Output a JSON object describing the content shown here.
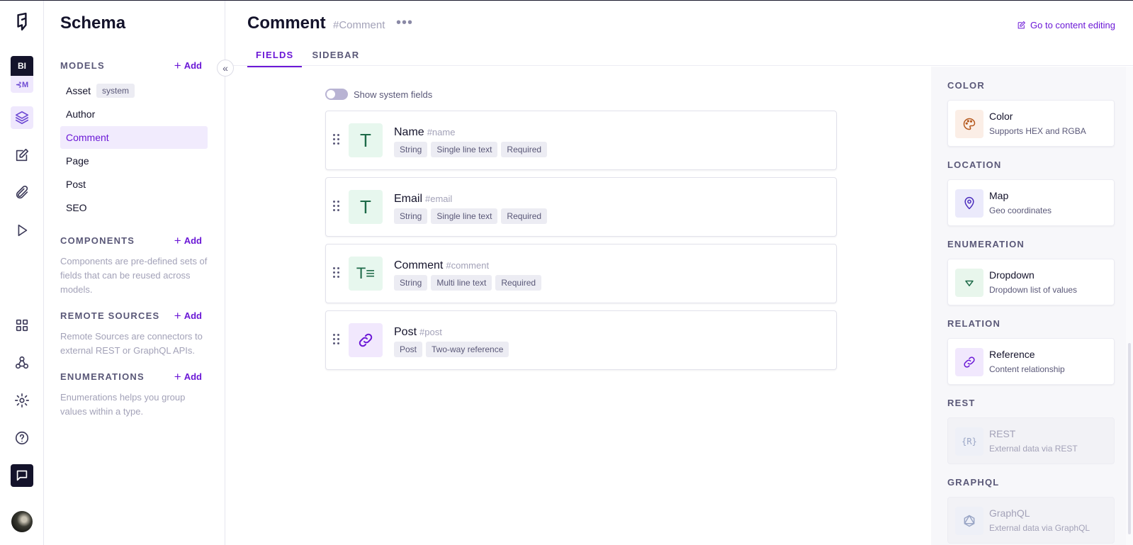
{
  "rail": {
    "project_initials": "BI",
    "project_sub": "⊰M",
    "items": [
      "logo-icon",
      "schema-icon",
      "content-icon",
      "assets-icon",
      "playground-icon",
      "apps-icon",
      "webhooks-icon",
      "settings-icon",
      "help-icon",
      "chat-icon"
    ]
  },
  "schema": {
    "title": "Schema",
    "models_title": "MODELS",
    "add_label": "Add",
    "models": [
      {
        "name": "Asset",
        "tag": "system"
      },
      {
        "name": "Author"
      },
      {
        "name": "Comment"
      },
      {
        "name": "Page"
      },
      {
        "name": "Post"
      },
      {
        "name": "SEO"
      }
    ],
    "components_title": "COMPONENTS",
    "components_desc": "Components are pre-defined sets of fields that can be reused across models.",
    "remote_title": "REMOTE SOURCES",
    "remote_desc": "Remote Sources are connectors to external REST or GraphQL APIs.",
    "enums_title": "ENUMERATIONS",
    "enums_desc": "Enumerations helps you group values within a type."
  },
  "main": {
    "title": "Comment",
    "api_id": "#Comment",
    "more": "•••",
    "tabs": [
      "FIELDS",
      "SIDEBAR"
    ],
    "goto_label": "Go to content editing",
    "toggle_label": "Show system fields",
    "fields": [
      {
        "name": "Name",
        "key": "#name",
        "icon": "T",
        "tags": [
          "String",
          "Single line text",
          "Required"
        ]
      },
      {
        "name": "Email",
        "key": "#email",
        "icon": "T",
        "tags": [
          "String",
          "Single line text",
          "Required"
        ]
      },
      {
        "name": "Comment",
        "key": "#comment",
        "icon": "T≡",
        "tags": [
          "String",
          "Multi line text",
          "Required"
        ]
      },
      {
        "name": "Post",
        "key": "#post",
        "icon": "link-icon",
        "tags": [
          "Post",
          "Two-way reference"
        ]
      }
    ]
  },
  "panel": {
    "categories": [
      {
        "title": "COLOR",
        "name": "Color",
        "desc": "Supports HEX and RGBA",
        "icon": "palette-icon",
        "enabled": true
      },
      {
        "title": "LOCATION",
        "name": "Map",
        "desc": "Geo coordinates",
        "icon": "map-pin-icon",
        "enabled": true
      },
      {
        "title": "ENUMERATION",
        "name": "Dropdown",
        "desc": "Dropdown list of values",
        "icon": "dropdown-icon",
        "enabled": true
      },
      {
        "title": "RELATION",
        "name": "Reference",
        "desc": "Content relationship",
        "icon": "link-icon",
        "enabled": true
      },
      {
        "title": "REST",
        "name": "REST",
        "desc": "External data via REST",
        "icon": "rest-icon",
        "enabled": false
      },
      {
        "title": "GRAPHQL",
        "name": "GraphQL",
        "desc": "External data via GraphQL",
        "icon": "graphql-icon",
        "enabled": false
      }
    ],
    "rest_icon_text": "{R}"
  },
  "colors": {
    "accent": "#6b18d6",
    "dark": "#14132b",
    "text_green_bg": "#e7f7ee"
  }
}
